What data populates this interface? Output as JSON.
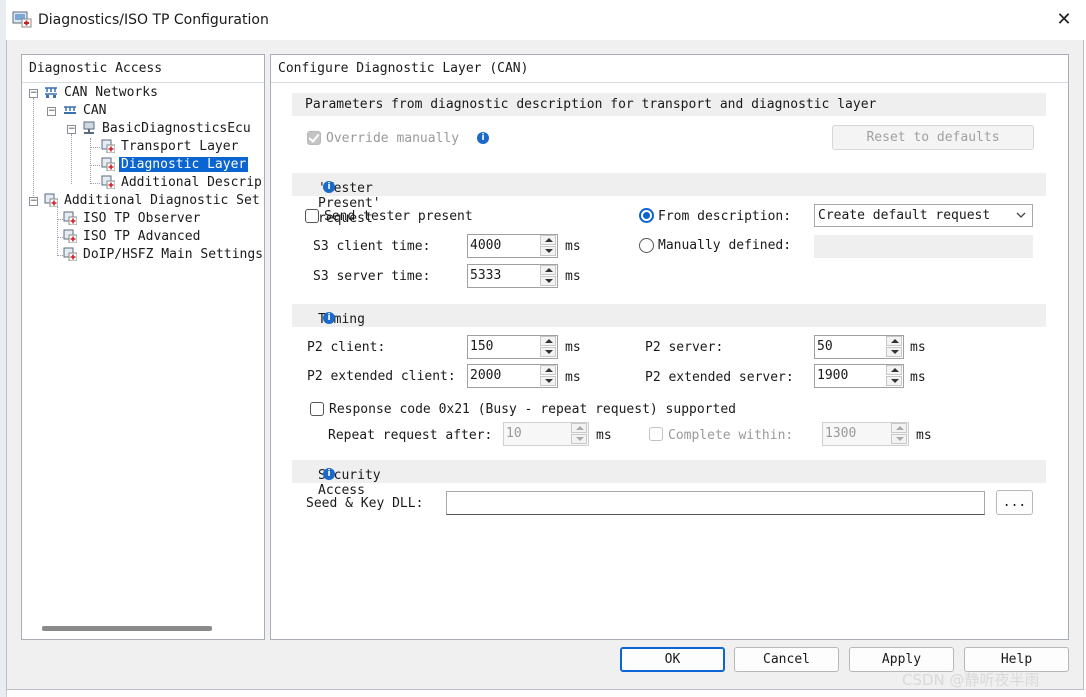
{
  "window": {
    "title": "Diagnostics/ISO TP Configuration",
    "close_glyph": "✕"
  },
  "left_panel": {
    "header": "Diagnostic Access",
    "tree": [
      {
        "label": "CAN Networks",
        "icon": "network-icon"
      },
      {
        "label": "CAN",
        "icon": "bus-icon"
      },
      {
        "label": "BasicDiagnosticsEcu",
        "icon": "ecu-icon"
      },
      {
        "label": "Transport Layer",
        "icon": "config-icon"
      },
      {
        "label": "Diagnostic Layer",
        "icon": "config-icon",
        "selected": true
      },
      {
        "label": "Additional Descrip",
        "icon": "config-icon"
      },
      {
        "label": "Additional Diagnostic Set",
        "icon": "config-folder-icon"
      },
      {
        "label": "ISO TP Observer",
        "icon": "config-icon"
      },
      {
        "label": "ISO TP Advanced",
        "icon": "config-icon"
      },
      {
        "label": "DoIP/HSFZ Main Settings",
        "icon": "config-icon"
      }
    ]
  },
  "right_panel": {
    "header": "Configure Diagnostic Layer (CAN)",
    "params": {
      "title": "Parameters from diagnostic description for transport and diagnostic layer",
      "override_label": "Override manually",
      "override_checked": true,
      "reset_label": "Reset to defaults"
    },
    "tester_present": {
      "title": "'Tester Present' request",
      "send_label": "Send tester present",
      "send_checked": false,
      "s3_client_label": "S3 client time:",
      "s3_client_value": "4000",
      "s3_server_label": "S3 server time:",
      "s3_server_value": "5333",
      "unit": "ms",
      "from_description_label": "From description:",
      "from_description_selected": true,
      "dropdown_value": "Create default request",
      "manually_defined_label": "Manually defined:"
    },
    "timing": {
      "title": "Timing",
      "p2_client_label": "P2 client:",
      "p2_client_value": "150",
      "p2_ext_client_label": "P2 extended client:",
      "p2_ext_client_value": "2000",
      "p2_server_label": "P2 server:",
      "p2_server_value": "50",
      "p2_ext_server_label": "P2 extended server:",
      "p2_ext_server_value": "1900",
      "unit": "ms",
      "response_label": "Response code 0x21 (Busy - repeat request) supported",
      "repeat_label": "Repeat request after:",
      "repeat_value": "10",
      "complete_label": "Complete within:",
      "complete_value": "1300"
    },
    "security": {
      "title": "Security Access",
      "seed_label": "Seed & Key DLL:",
      "seed_value": "",
      "browse_label": "..."
    }
  },
  "buttons": {
    "ok": "OK",
    "cancel": "Cancel",
    "apply": "Apply",
    "help": "Help"
  },
  "watermark": "CSDN @静听夜半雨",
  "colors": {
    "accent": "#0a64d2",
    "info": "#1b6ac9",
    "section_bg": "#efefef"
  }
}
